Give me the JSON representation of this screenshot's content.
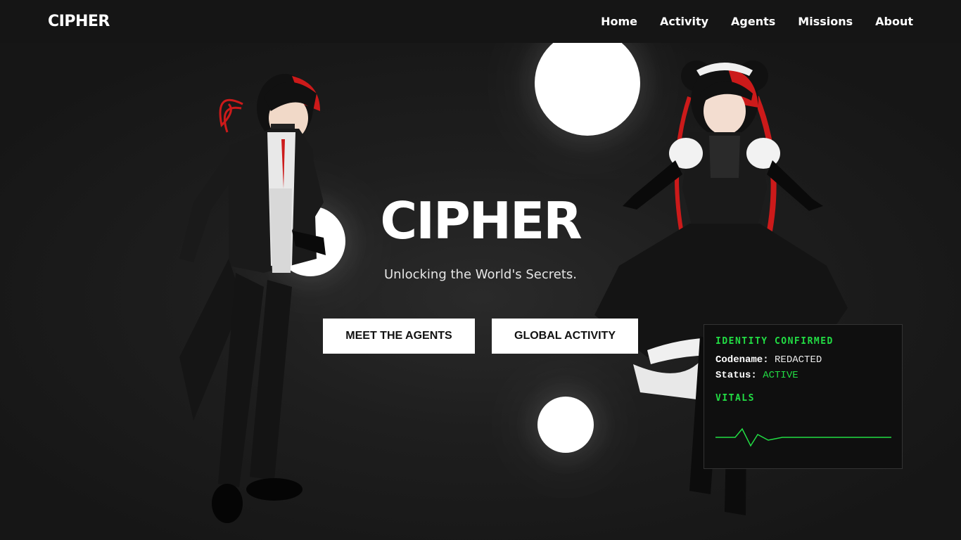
{
  "header": {
    "brand": "CIPHER",
    "nav": [
      "Home",
      "Activity",
      "Agents",
      "Missions",
      "About"
    ]
  },
  "hero": {
    "title": "CIPHER",
    "subtitle": "Unlocking the World's Secrets.",
    "primary_button": "MEET THE AGENTS",
    "secondary_button": "GLOBAL ACTIVITY"
  },
  "identity_panel": {
    "heading": "IDENTITY CONFIRMED",
    "codename_label": "Codename:",
    "codename_value": "REDACTED",
    "status_label": "Status:",
    "status_value": "ACTIVE",
    "vitals_heading": "VITALS"
  },
  "colors": {
    "accent_green": "#22dd44",
    "background": "#1e1e1e",
    "header_bg": "#151515",
    "character_red": "#cc1a1a"
  },
  "icons": {
    "characters": [
      "butler-character-illustration",
      "maid-character-illustration"
    ]
  }
}
